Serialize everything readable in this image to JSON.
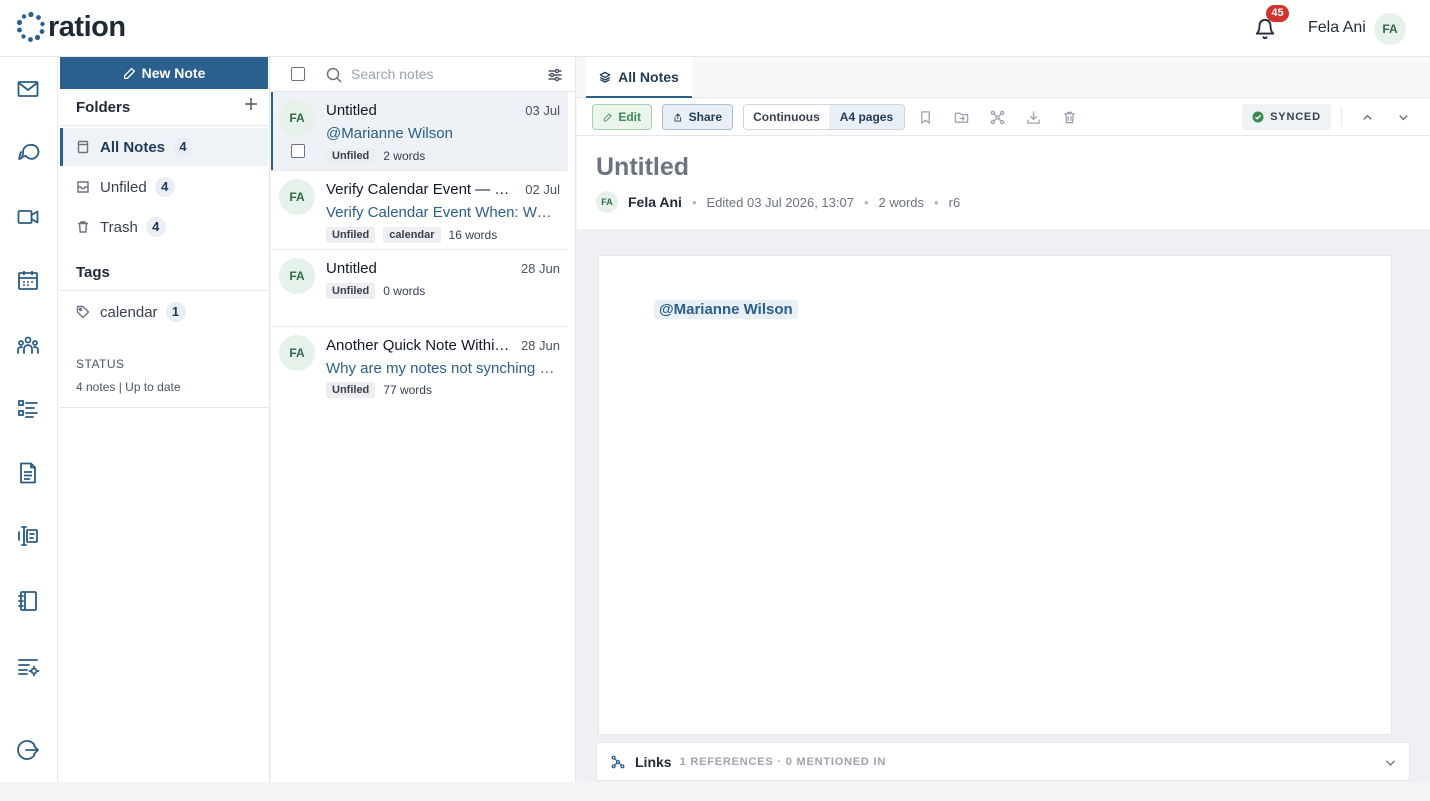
{
  "brand": {
    "name": "ration"
  },
  "header": {
    "notification_count": "45",
    "user_name": "Fela Ani",
    "user_initials": "FA"
  },
  "rail": {
    "icons": [
      "mail-icon",
      "chat-icon",
      "video-icon",
      "calendar-icon",
      "team-icon",
      "tasks-icon",
      "document-icon",
      "contracts-icon",
      "notebook-icon",
      "settings-list-icon",
      "logout-icon"
    ]
  },
  "folders": {
    "new_note_label": "New Note",
    "title": "Folders",
    "items": [
      {
        "label": "All Notes",
        "count": "4"
      },
      {
        "label": "Unfiled",
        "count": "4"
      },
      {
        "label": "Trash",
        "count": "4"
      }
    ],
    "tags_title": "Tags",
    "tags": [
      {
        "label": "calendar",
        "count": "1"
      }
    ],
    "status_label": "STATUS",
    "status_text": "4 notes | Up to date"
  },
  "notelist": {
    "search_placeholder": "Search notes",
    "notes": [
      {
        "initials": "FA",
        "title": "Untitled",
        "date": "03 Jul",
        "preview": "@Marianne Wilson",
        "tags": [
          "Unfiled"
        ],
        "words": "2 words"
      },
      {
        "initials": "FA",
        "title": "Verify Calendar Event — No...",
        "date": "02 Jul",
        "preview": "Verify Calendar Event When: Wed...",
        "tags": [
          "Unfiled",
          "calendar"
        ],
        "words": "16 words"
      },
      {
        "initials": "FA",
        "title": "Untitled",
        "date": "28 Jun",
        "preview": "",
        "tags": [
          "Unfiled"
        ],
        "words": "0 words"
      },
      {
        "initials": "FA",
        "title": "Another Quick Note Within ...",
        "date": "28 Jun",
        "preview": "Why are my notes not synching au...",
        "tags": [
          "Unfiled"
        ],
        "words": "77 words"
      }
    ]
  },
  "editor": {
    "tab_label": "All Notes",
    "toolbar": {
      "edit_label": "Edit",
      "share_label": "Share",
      "view_options": [
        "Continuous",
        "A4 pages"
      ],
      "selected_view": "A4 pages",
      "sync_status": "SYNCED"
    },
    "doc": {
      "title": "Untitled",
      "author_initials": "FA",
      "author": "Fela Ani",
      "edited": "Edited 03 Jul 2026, 13:07",
      "words": "2 words",
      "revision": "r6",
      "mention": "@Marianne Wilson"
    },
    "links": {
      "label": "Links",
      "summary": "1 REFERENCES · 0 MENTIONED IN"
    }
  },
  "colors": {
    "accent": "#2b5f8d",
    "sync_green": "#3d8a52",
    "badge_red": "#d0342c"
  }
}
